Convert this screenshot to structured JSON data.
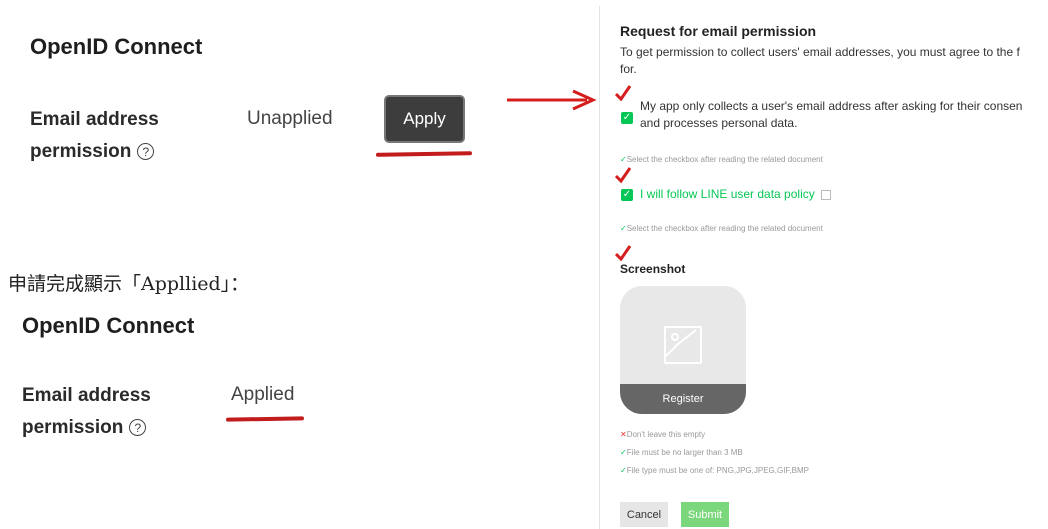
{
  "top_section": {
    "title": "OpenID Connect",
    "label_line1": "Email address",
    "label_line2": "permission",
    "help_icon": "?",
    "status": "Unapplied",
    "apply_label": "Apply"
  },
  "note": "申請完成顯示「Appllied」：",
  "bottom_section": {
    "title": "OpenID Connect",
    "label_line1": "Email address",
    "label_line2": "permission",
    "help_icon": "?",
    "status": "Applied"
  },
  "annotation_color": "#d51d1d",
  "dialog": {
    "title": "Request for email permission",
    "intro_line1": "To get permission to collect users' email addresses, you must agree to the f",
    "intro_line2": "for.",
    "check1_line1": "My app only collects a user's email address after asking for their consen",
    "check1_line2": "and processes personal data.",
    "hint1": "Select the checkbox after reading the related document",
    "check2_label": "I will follow LINE user data policy",
    "hint2": "Select the checkbox after reading the related document",
    "screenshot_title": "Screenshot",
    "register_label": "Register",
    "error_hint": "Don't leave this empty",
    "size_hint": "File must be no larger than 3 MB",
    "type_hint": "File type must be one of: PNG,JPG,JPEG,GIF,BMP",
    "cancel_label": "Cancel",
    "submit_label": "Submit",
    "accent": "#06c755"
  }
}
